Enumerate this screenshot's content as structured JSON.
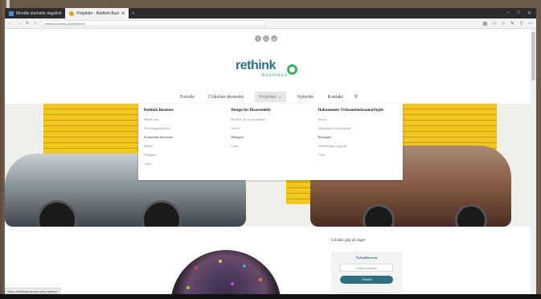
{
  "browser": {
    "tabs": [
      {
        "label": "Moodle startside dagslink"
      },
      {
        "label": "Projekter - Rethink Busi"
      }
    ],
    "url": "rethinkbusiness.dk/projekter/",
    "status_url": "https://rethinkbusiness.dk/projekter/"
  },
  "site": {
    "logo_word": "rethink",
    "logo_sub": "business",
    "nav": [
      {
        "label": "Forside"
      },
      {
        "label": "Cirkulær økonomi"
      },
      {
        "label": "Projekter"
      },
      {
        "label": "Nyheder"
      },
      {
        "label": "Kontakt"
      }
    ]
  },
  "dropdown": {
    "columns": [
      {
        "title": "Rethink Business",
        "items": [
          "Mindre om",
          "Forretningsmodeller",
          "Kommende aktiviteter",
          "Medier",
          "Deltagere",
          "Cases"
        ]
      },
      {
        "title": "Design for Disassembly",
        "items": [
          "Hvad Er det for produkter?",
          "Proces",
          "Deltagere",
          "Cases"
        ]
      },
      {
        "title": "Dokumenter Virksomhedssamarbejde",
        "items": [
          "Proces",
          "Deltagende virksomheder",
          "Erfaringer",
          "Anbefalinger og guide",
          "Cases"
        ]
      }
    ]
  },
  "sidebar": {
    "title": "Gå ikke glip af noget",
    "newsletter_heading": "Nyhedsbrevet",
    "email_placeholder": "Email-adresse",
    "button_label": "Tilmeld"
  },
  "colors": {
    "brand_blue": "#2e6f84",
    "brand_green": "#3fae5f",
    "shutter_yellow": "#f2c71f"
  }
}
